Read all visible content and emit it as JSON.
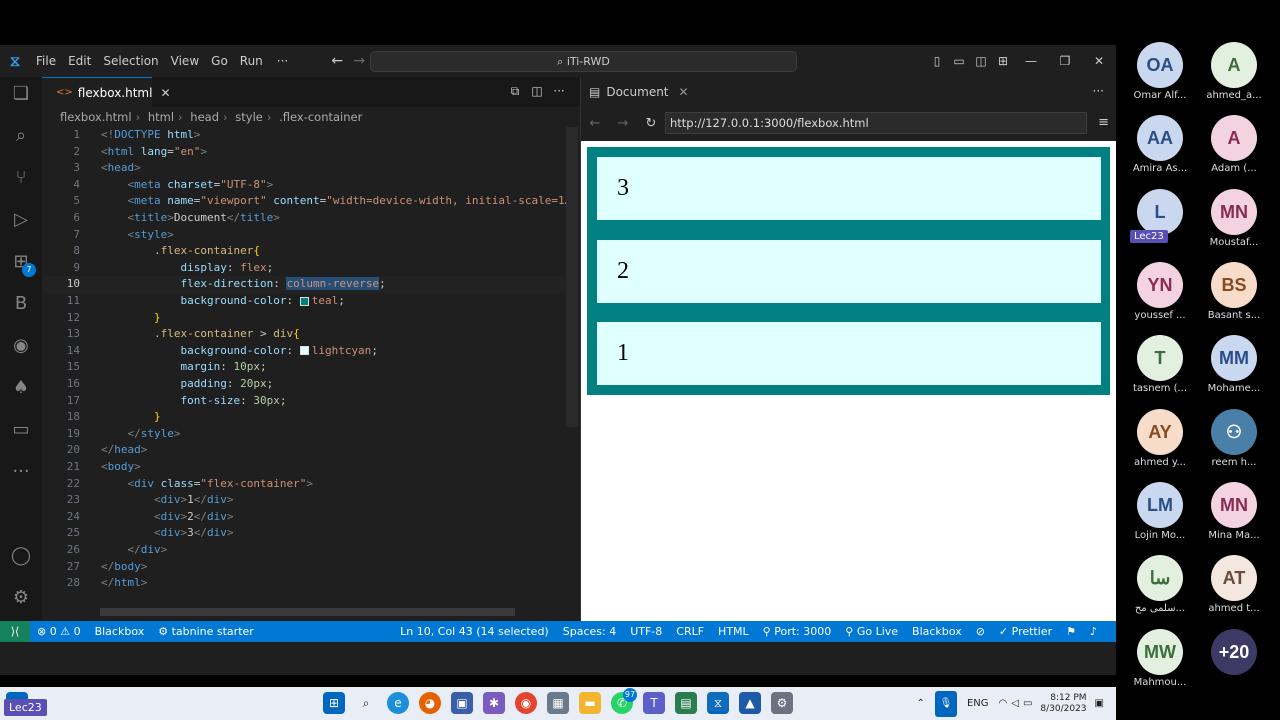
{
  "menu": [
    "File",
    "Edit",
    "Selection",
    "View",
    "Go",
    "Run",
    "···"
  ],
  "command_center": "⌕ iTi-RWD",
  "editor": {
    "tab_label": "flexbox.html",
    "breadcrumb": [
      "flexbox.html",
      "html",
      "head",
      "style",
      ".flex-container"
    ]
  },
  "code_lines": [
    {
      "n": "1"
    },
    {
      "n": "2"
    },
    {
      "n": "3"
    },
    {
      "n": "4"
    },
    {
      "n": "5"
    },
    {
      "n": "6"
    },
    {
      "n": "7"
    },
    {
      "n": "8"
    },
    {
      "n": "9"
    },
    {
      "n": "10"
    },
    {
      "n": "11"
    },
    {
      "n": "12"
    },
    {
      "n": "13"
    },
    {
      "n": "14"
    },
    {
      "n": "15"
    },
    {
      "n": "16"
    },
    {
      "n": "17"
    },
    {
      "n": "18"
    },
    {
      "n": "19"
    },
    {
      "n": "20"
    },
    {
      "n": "21"
    },
    {
      "n": "22"
    },
    {
      "n": "23"
    },
    {
      "n": "24"
    },
    {
      "n": "25"
    },
    {
      "n": "26"
    },
    {
      "n": "27"
    },
    {
      "n": "28"
    }
  ],
  "browser": {
    "tab_label": "Document",
    "url": "http://127.0.0.1:3000/flexbox.html",
    "items": [
      "3",
      "2",
      "1"
    ]
  },
  "statusbar": {
    "errors": "⊗ 0 ⚠ 0",
    "blackbox_left": "Blackbox",
    "tabnine": "⚙ tabnine starter",
    "position": "Ln 10, Col 43 (14 selected)",
    "spaces": "Spaces: 4",
    "encoding": "UTF-8",
    "eol": "CRLF",
    "language": "HTML",
    "port": "Port: 3000",
    "golive": "Go Live",
    "blackbox_right": "Blackbox",
    "prettier": "Prettier"
  },
  "taskbar": {
    "lang": "ENG",
    "time": "8:12 PM",
    "date": "8/30/2023",
    "whatsapp_badge": "97"
  },
  "participants": [
    {
      "initials": "OA",
      "name": "Omar Alf...",
      "bg": "#c9d8ef",
      "fg": "#2b4d8a"
    },
    {
      "initials": "A",
      "name": "ahmed_a...",
      "bg": "#e3f0e0",
      "fg": "#3c6e3a"
    },
    {
      "initials": "AA",
      "name": "Amira As...",
      "bg": "#c9d8ef",
      "fg": "#2b4d8a"
    },
    {
      "initials": "A",
      "name": "Adam (...",
      "bg": "#f3d3e0",
      "fg": "#8a2b55"
    },
    {
      "initials": "L",
      "name": "Lec23",
      "bg": "#c9d8ef",
      "fg": "#2b4d8a"
    },
    {
      "initials": "MN",
      "name": "Moustaf...",
      "bg": "#f3d3e0",
      "fg": "#8a2b55"
    },
    {
      "initials": "YN",
      "name": "youssef ...",
      "bg": "#f3d3e0",
      "fg": "#8a2b55"
    },
    {
      "initials": "BS",
      "name": "Basant s...",
      "bg": "#f6dcc9",
      "fg": "#8a4a1f"
    },
    {
      "initials": "T",
      "name": "tasnem (...",
      "bg": "#e3f0e0",
      "fg": "#3c6e3a"
    },
    {
      "initials": "MM",
      "name": "Mohame...",
      "bg": "#c9d8ef",
      "fg": "#2b4d8a"
    },
    {
      "initials": "AY",
      "name": "ahmed y...",
      "bg": "#f6dcc9",
      "fg": "#8a4a1f"
    },
    {
      "initials": "",
      "name": "reem h...",
      "bg": "#4a7fa8",
      "fg": "#ffffff"
    },
    {
      "initials": "LM",
      "name": "Lojin Mo...",
      "bg": "#c9d8ef",
      "fg": "#2b4d8a"
    },
    {
      "initials": "MN",
      "name": "Mina Ma...",
      "bg": "#f3d3e0",
      "fg": "#8a2b55"
    },
    {
      "initials": "سا",
      "name": "سلمى مح...",
      "bg": "#e3f0e0",
      "fg": "#3c6e3a"
    },
    {
      "initials": "AT",
      "name": "ahmed t...",
      "bg": "#f3e7e0",
      "fg": "#6a4a3a"
    },
    {
      "initials": "MW",
      "name": "Mahmou...",
      "bg": "#e3f0e0",
      "fg": "#3c6e3a"
    },
    {
      "initials": "+20",
      "name": "",
      "bg": "#3d3a66",
      "fg": "#ffffff"
    }
  ],
  "lec_tag": "Lec23",
  "bottom_tag": "Lec23",
  "colors": {
    "accent": "#0078d4",
    "teal": "teal",
    "lightcyan": "lightcyan"
  }
}
